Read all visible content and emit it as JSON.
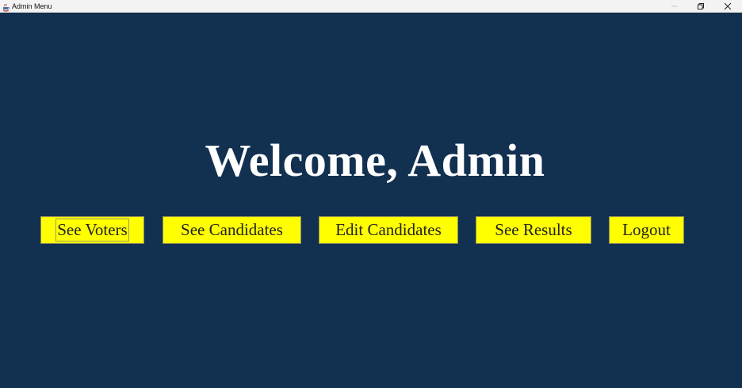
{
  "window": {
    "title": "Admin Menu",
    "app_icon": "java-app-icon",
    "controls": [
      "minimize-icon",
      "restore-icon",
      "close-icon"
    ]
  },
  "main": {
    "heading": "Welcome, Admin",
    "buttons": [
      {
        "label": "See Voters",
        "focused": true
      },
      {
        "label": "See Candidates"
      },
      {
        "label": "Edit Candidates"
      },
      {
        "label": "See Results"
      },
      {
        "label": "Logout"
      }
    ]
  },
  "colors": {
    "background": "#12304f",
    "button_bg": "#ffff00",
    "heading_text": "#ffffff"
  }
}
